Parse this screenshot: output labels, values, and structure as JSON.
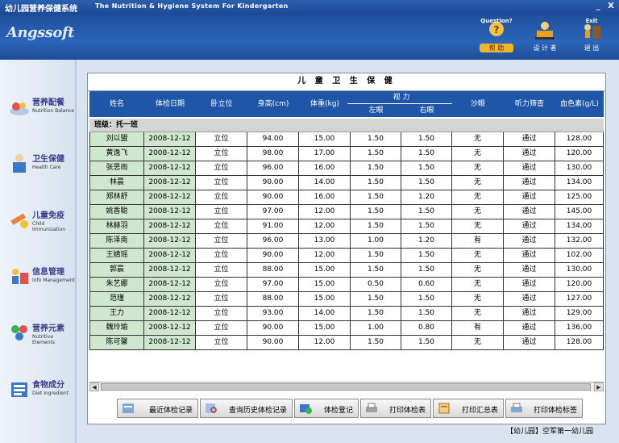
{
  "window": {
    "title_cn": "幼儿园营养保健系统",
    "title_en": "The Nutrition & Hygiene System For Kindergarten",
    "minimize": "_",
    "close": "X"
  },
  "header": {
    "logo": "Angssoft",
    "buttons": [
      {
        "tag": "Question?",
        "label": "帮  助",
        "icon": "help-icon"
      },
      {
        "tag": "",
        "label": "设 计 者",
        "icon": "designer-icon"
      },
      {
        "tag": "Exit",
        "label": "退  出",
        "icon": "exit-icon"
      }
    ]
  },
  "sidebar": {
    "items": [
      {
        "cn": "营养配餐",
        "en": "Nutrition Balance",
        "icon": "nutrition-icon"
      },
      {
        "cn": "卫生保健",
        "en": "Health  Care",
        "icon": "doctor-icon"
      },
      {
        "cn": "儿童免疫",
        "en": "Child Immunization",
        "icon": "immunization-icon"
      },
      {
        "cn": "信息管理",
        "en": "Info Management",
        "icon": "info-icon"
      },
      {
        "cn": "营养元素",
        "en": "Nutritive Elements",
        "icon": "elements-icon"
      },
      {
        "cn": "食物成分",
        "en": "Diet Ingredient",
        "icon": "diet-icon"
      }
    ]
  },
  "report": {
    "title": "儿 童 卫 生 保 健",
    "headers": {
      "name": "姓名",
      "date": "体检日期",
      "posture": "卧立位",
      "height": "身高(cm)",
      "weight": "体重(kg)",
      "vision": "视  力",
      "left_eye": "左眼",
      "right_eye": "右眼",
      "trachoma": "沙眼",
      "hearing": "听力筛查",
      "hemoglobin": "血色素(g/L)"
    },
    "class_label": "班级：托一班",
    "rows": [
      [
        "刘以盟",
        "2008-12-12",
        "立位",
        "94.00",
        "15.00",
        "1.50",
        "1.50",
        "无",
        "通过",
        "128.00"
      ],
      [
        "黄逸飞",
        "2008-12-12",
        "立位",
        "98.00",
        "17.00",
        "1.50",
        "1.50",
        "无",
        "通过",
        "120.00"
      ],
      [
        "张思雨",
        "2008-12-12",
        "立位",
        "96.00",
        "16.00",
        "1.50",
        "1.50",
        "无",
        "通过",
        "130.00"
      ],
      [
        "林晨",
        "2008-12-12",
        "立位",
        "90.00",
        "14.00",
        "1.50",
        "1.50",
        "无",
        "通过",
        "134.00"
      ],
      [
        "郑林舒",
        "2008-12-12",
        "立位",
        "90.00",
        "16.00",
        "1.50",
        "1.20",
        "无",
        "通过",
        "125.00"
      ],
      [
        "姚香聪",
        "2008-12-12",
        "立位",
        "97.00",
        "12.00",
        "1.50",
        "1.50",
        "无",
        "通过",
        "145.00"
      ],
      [
        "林赫羽",
        "2008-12-12",
        "立位",
        "91.00",
        "12.00",
        "1.50",
        "1.50",
        "无",
        "通过",
        "134.00"
      ],
      [
        "陈泽南",
        "2008-12-12",
        "立位",
        "96.00",
        "13.00",
        "1.00",
        "1.20",
        "有",
        "通过",
        "132.00"
      ],
      [
        "王婧瑶",
        "2008-12-12",
        "立位",
        "90.00",
        "12.00",
        "1.50",
        "1.50",
        "无",
        "通过",
        "102.00"
      ],
      [
        "郭晨",
        "2008-12-12",
        "立位",
        "88.00",
        "15.00",
        "1.50",
        "1.50",
        "无",
        "通过",
        "130.00"
      ],
      [
        "朱艺娜",
        "2008-12-12",
        "立位",
        "97.00",
        "15.00",
        "0.50",
        "0.60",
        "无",
        "通过",
        "120.00"
      ],
      [
        "范瑾",
        "2008-12-12",
        "立位",
        "88.00",
        "15.00",
        "1.50",
        "1.50",
        "无",
        "通过",
        "127.00"
      ],
      [
        "王力",
        "2008-12-12",
        "立位",
        "93.00",
        "14.00",
        "1.50",
        "1.50",
        "无",
        "通过",
        "129.00"
      ],
      [
        "魏玲瑜",
        "2008-12-12",
        "立位",
        "90.00",
        "15.00",
        "1.00",
        "0.80",
        "有",
        "通过",
        "136.00"
      ],
      [
        "陈可馨",
        "2008-12-12",
        "立位",
        "90.00",
        "12.00",
        "1.50",
        "1.50",
        "无",
        "通过",
        "128.00"
      ]
    ]
  },
  "toolbar": {
    "buttons": [
      {
        "label": "最近体检记录",
        "icon": "recent-records-icon"
      },
      {
        "label": "查询历史体检记录",
        "icon": "history-search-icon"
      },
      {
        "label": "体检登记",
        "icon": "register-icon"
      },
      {
        "label": "打印体检表",
        "icon": "print-form-icon"
      },
      {
        "label": "打印汇总表",
        "icon": "print-summary-icon"
      },
      {
        "label": "打印体检标签",
        "icon": "print-label-icon"
      }
    ]
  },
  "status": "【幼儿园】空军第一幼儿园"
}
